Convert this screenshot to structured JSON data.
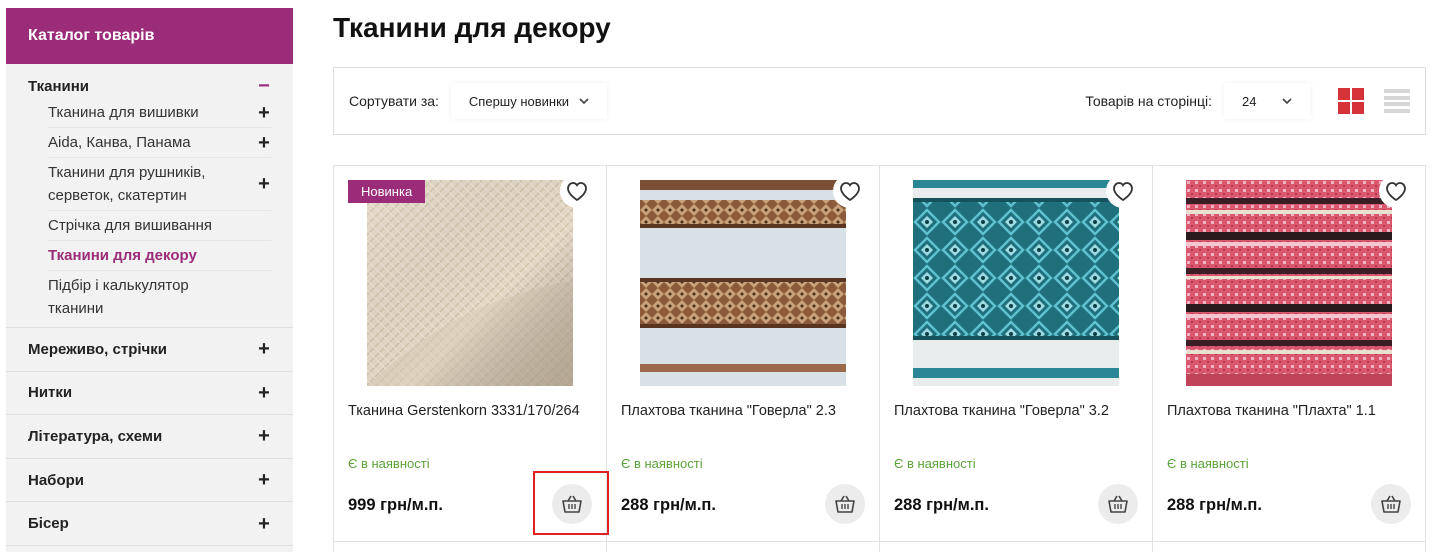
{
  "sidebar": {
    "header": "Каталог товарів",
    "open_category": {
      "label": "Тканини",
      "toggle": "−",
      "subitems": [
        {
          "label": "Тканина для вишивки",
          "toggle": "+"
        },
        {
          "label": "Aida, Канва, Панама",
          "toggle": "+"
        },
        {
          "label": "Тканини для рушників, серветок, скатертин",
          "toggle": "+"
        },
        {
          "label": "Стрічка для вишивання",
          "toggle": ""
        },
        {
          "label": "Тканини для декору",
          "toggle": "",
          "active": true
        },
        {
          "label": "Підбір і калькулятор тканини",
          "toggle": ""
        }
      ]
    },
    "categories": [
      {
        "label": "Мереживо, стрічки",
        "toggle": "+"
      },
      {
        "label": "Нитки",
        "toggle": "+"
      },
      {
        "label": "Література, схеми",
        "toggle": "+"
      },
      {
        "label": "Набори",
        "toggle": "+"
      },
      {
        "label": "Бісер",
        "toggle": "+"
      }
    ]
  },
  "main": {
    "title": "Тканини для декору",
    "toolbar": {
      "sort_label": "Сортувати за:",
      "sort_value": "Спершу новинки",
      "per_page_label": "Товарів на сторінці:",
      "per_page_value": "24",
      "views": [
        "grid-view-icon",
        "list-view-icon"
      ],
      "active_view": "grid"
    },
    "products": [
      {
        "badge": "Новинка",
        "name": "Тканина Gerstenkorn 3331/170/264",
        "stock": "Є в наявності",
        "price": "999 грн/м.п.",
        "image": "beige-weave"
      },
      {
        "badge": "",
        "name": "Плахтова тканина \"Говерла\" 2.3",
        "stock": "Є в наявності",
        "price": "288 грн/м.п.",
        "image": "brown-stripes"
      },
      {
        "badge": "",
        "name": "Плахтова тканина \"Говерла\" 3.2",
        "stock": "Є в наявності",
        "price": "288 грн/м.п.",
        "image": "blue-ornament"
      },
      {
        "badge": "",
        "name": "Плахтова тканина \"Плахта\" 1.1",
        "stock": "Є в наявності",
        "price": "288 грн/м.п.",
        "image": "pink-stripes"
      }
    ]
  },
  "colors": {
    "brand": "#9b2c79",
    "stock_green": "#5aa33a",
    "grid_active": "#d6323a",
    "highlight": "#e02020"
  }
}
